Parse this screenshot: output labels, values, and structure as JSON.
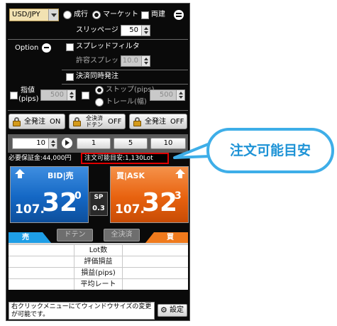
{
  "header": {
    "currency_pair": "USD/JPY",
    "order_type_options": [
      "成行",
      "マーケット"
    ],
    "order_type_selected": "マーケット",
    "ryodate_label": "両建",
    "slippage_label": "スリッページ",
    "slippage_value": "50"
  },
  "option": {
    "label": "Option",
    "spread_filter_label": "スプレッドフィルタ",
    "allowed_spread_label": "許容スプレッド",
    "allowed_spread_value": "10.0",
    "settlement_order_label": "決済同時発注",
    "limit_label_line1": "指値",
    "limit_label_line2": "(pips)",
    "limit_value": "500",
    "stop_label": "ストップ(pips)",
    "trail_label": "トレール(幅)",
    "stop_value": "500"
  },
  "toggles": {
    "all_order_label": "全発注",
    "all_order_state": "ON",
    "all_settle_label_line1": "全決済",
    "all_settle_label_line2": "ドテン",
    "all_settle_state": "OFF",
    "all_order_off_label": "全発注",
    "all_order_off_state": "OFF"
  },
  "quantity": {
    "value": "10",
    "quick_buttons": [
      "1",
      "5",
      "10"
    ]
  },
  "margin": {
    "required_margin_text": "必要保証金:44,000円",
    "order_possible_text": "注文可能目安:1,130Lot"
  },
  "bid": {
    "label": "BID|売",
    "price_prefix": "107.",
    "price_big": "32",
    "price_small": "0"
  },
  "ask": {
    "label": "買|ASK",
    "price_prefix": "107.",
    "price_big": "32",
    "price_small": "3"
  },
  "spread": {
    "label": "SP",
    "value": "0.3"
  },
  "actions": {
    "doten_label": "ドテン",
    "settle_all_label": "全決済"
  },
  "positions": {
    "sell_header": "売",
    "buy_header": "買",
    "rows": [
      "Lot数",
      "評価損益",
      "損益(pips)",
      "平均レート"
    ]
  },
  "footer": {
    "hint_text": "右クリックメニューにてウィンドウサイズの変更が可能です。",
    "settings_label": "設定"
  },
  "callout": {
    "text": "注文可能目安"
  },
  "colors": {
    "bid_blue": "#1467c4",
    "ask_orange": "#e8620f",
    "callout_blue": "#3eaee8",
    "highlight_red": "#e00000"
  }
}
